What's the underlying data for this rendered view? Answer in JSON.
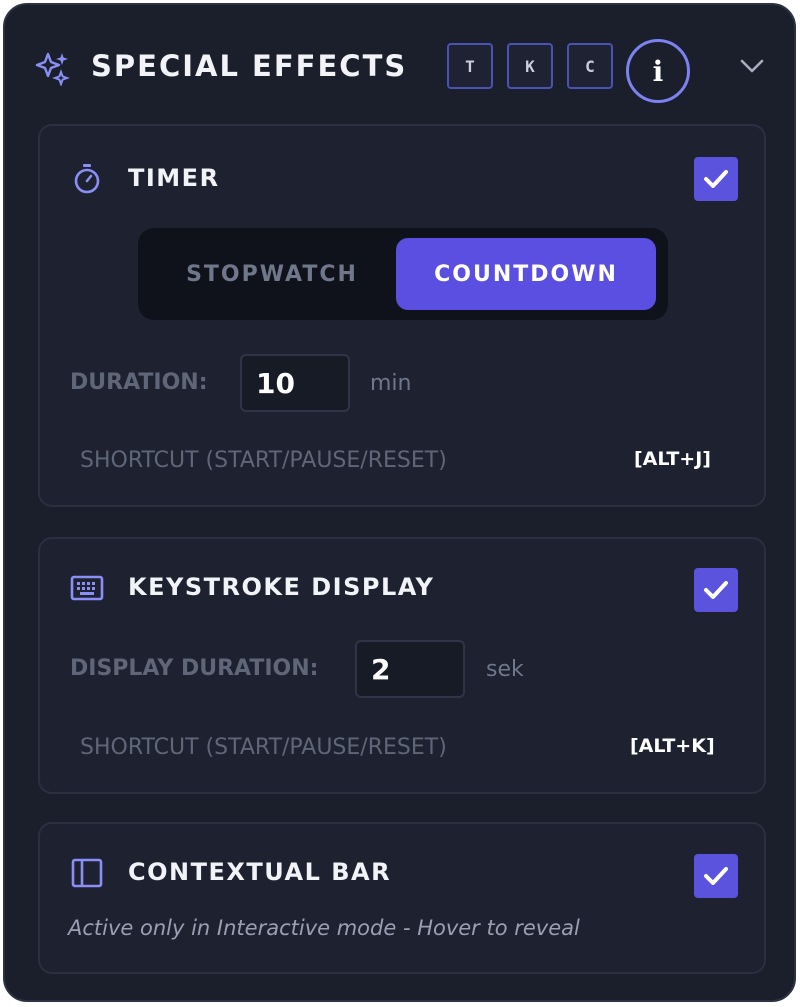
{
  "header": {
    "title": "SPECIAL EFFECTS",
    "keys": [
      "T",
      "K",
      "C"
    ],
    "info_label": "i"
  },
  "timer": {
    "title": "TIMER",
    "enabled": true,
    "modes": [
      "STOPWATCH",
      "COUNTDOWN"
    ],
    "active_mode": "COUNTDOWN",
    "duration_label": "DURATION:",
    "duration_value": "10",
    "duration_unit": "min",
    "shortcut_label": "SHORTCUT (START/PAUSE/RESET)",
    "shortcut_key": "[ALT+J]"
  },
  "keystroke": {
    "title": "KEYSTROKE DISPLAY",
    "enabled": true,
    "duration_label": "DISPLAY DURATION:",
    "duration_value": "2",
    "duration_unit": "sek",
    "shortcut_label": "SHORTCUT (START/PAUSE/RESET)",
    "shortcut_key": "[ALT+K]"
  },
  "contextual": {
    "title": "CONTEXTUAL BAR",
    "enabled": true,
    "note": "Active only in Interactive mode - Hover to reveal"
  },
  "icons": {
    "header": "sparkles-icon",
    "timer": "stopwatch-icon",
    "keystroke": "keyboard-icon",
    "contextual": "sidebar-panel-icon",
    "collapse": "chevron-down-icon",
    "check": "checkmark-icon"
  },
  "colors": {
    "accent": "#5a4fe0",
    "panel_bg": "#1b1f2b",
    "card_bg": "#1d2130",
    "muted_text": "#5f6677"
  }
}
